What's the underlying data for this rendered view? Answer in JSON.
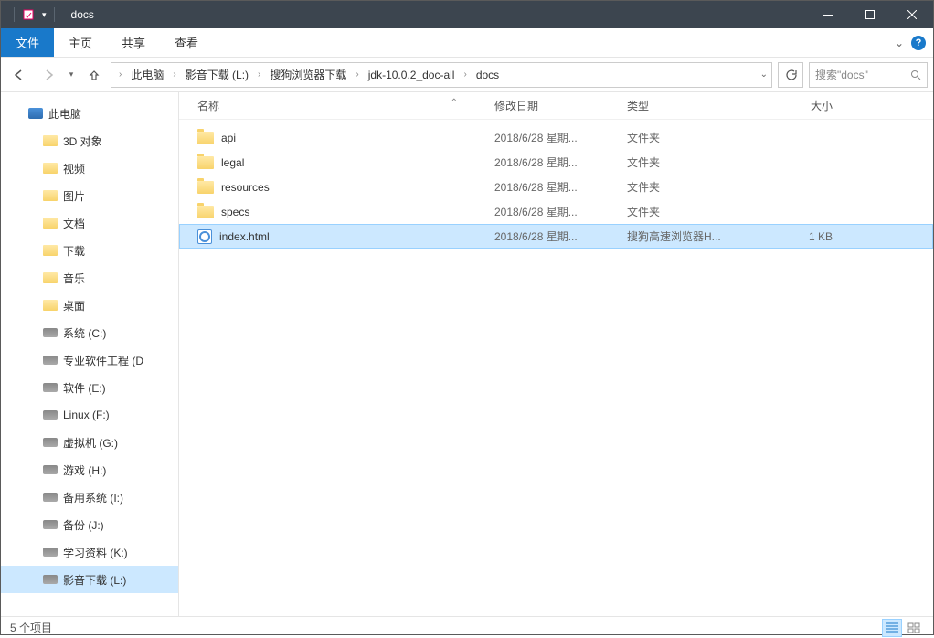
{
  "window": {
    "title": "docs"
  },
  "ribbon": {
    "file": "文件",
    "home": "主页",
    "share": "共享",
    "view": "查看"
  },
  "breadcrumb": [
    "此电脑",
    "影音下载 (L:)",
    "搜狗浏览器下载",
    "jdk-10.0.2_doc-all",
    "docs"
  ],
  "search": {
    "placeholder": "搜索\"docs\""
  },
  "columns": {
    "name": "名称",
    "date": "修改日期",
    "type": "类型",
    "size": "大小"
  },
  "tree": [
    {
      "label": "此电脑",
      "icon": "monitor",
      "indent": false
    },
    {
      "label": "3D 对象",
      "icon": "fldr",
      "indent": true
    },
    {
      "label": "视频",
      "icon": "fldr",
      "indent": true
    },
    {
      "label": "图片",
      "icon": "fldr",
      "indent": true
    },
    {
      "label": "文档",
      "icon": "fldr",
      "indent": true
    },
    {
      "label": "下载",
      "icon": "fldr",
      "indent": true
    },
    {
      "label": "音乐",
      "icon": "fldr",
      "indent": true
    },
    {
      "label": "桌面",
      "icon": "fldr",
      "indent": true
    },
    {
      "label": "系统 (C:)",
      "icon": "drive",
      "indent": true
    },
    {
      "label": "专业软件工程 (D",
      "icon": "drive",
      "indent": true
    },
    {
      "label": "软件 (E:)",
      "icon": "drive",
      "indent": true
    },
    {
      "label": "Linux (F:)",
      "icon": "drive",
      "indent": true
    },
    {
      "label": "虚拟机 (G:)",
      "icon": "drive",
      "indent": true
    },
    {
      "label": "游戏 (H:)",
      "icon": "drive",
      "indent": true
    },
    {
      "label": "备用系统 (I:)",
      "icon": "drive",
      "indent": true
    },
    {
      "label": "备份 (J:)",
      "icon": "drive",
      "indent": true
    },
    {
      "label": "学习资料 (K:)",
      "icon": "drive",
      "indent": true
    },
    {
      "label": "影音下载 (L:)",
      "icon": "drive",
      "indent": true,
      "selected": true
    }
  ],
  "files": [
    {
      "name": "api",
      "date": "2018/6/28 星期...",
      "type": "文件夹",
      "size": "",
      "icon": "folder"
    },
    {
      "name": "legal",
      "date": "2018/6/28 星期...",
      "type": "文件夹",
      "size": "",
      "icon": "folder"
    },
    {
      "name": "resources",
      "date": "2018/6/28 星期...",
      "type": "文件夹",
      "size": "",
      "icon": "folder"
    },
    {
      "name": "specs",
      "date": "2018/6/28 星期...",
      "type": "文件夹",
      "size": "",
      "icon": "folder"
    },
    {
      "name": "index.html",
      "date": "2018/6/28 星期...",
      "type": "搜狗高速浏览器H...",
      "size": "1 KB",
      "icon": "html",
      "selected": true
    }
  ],
  "status": {
    "text": "5 个项目"
  }
}
